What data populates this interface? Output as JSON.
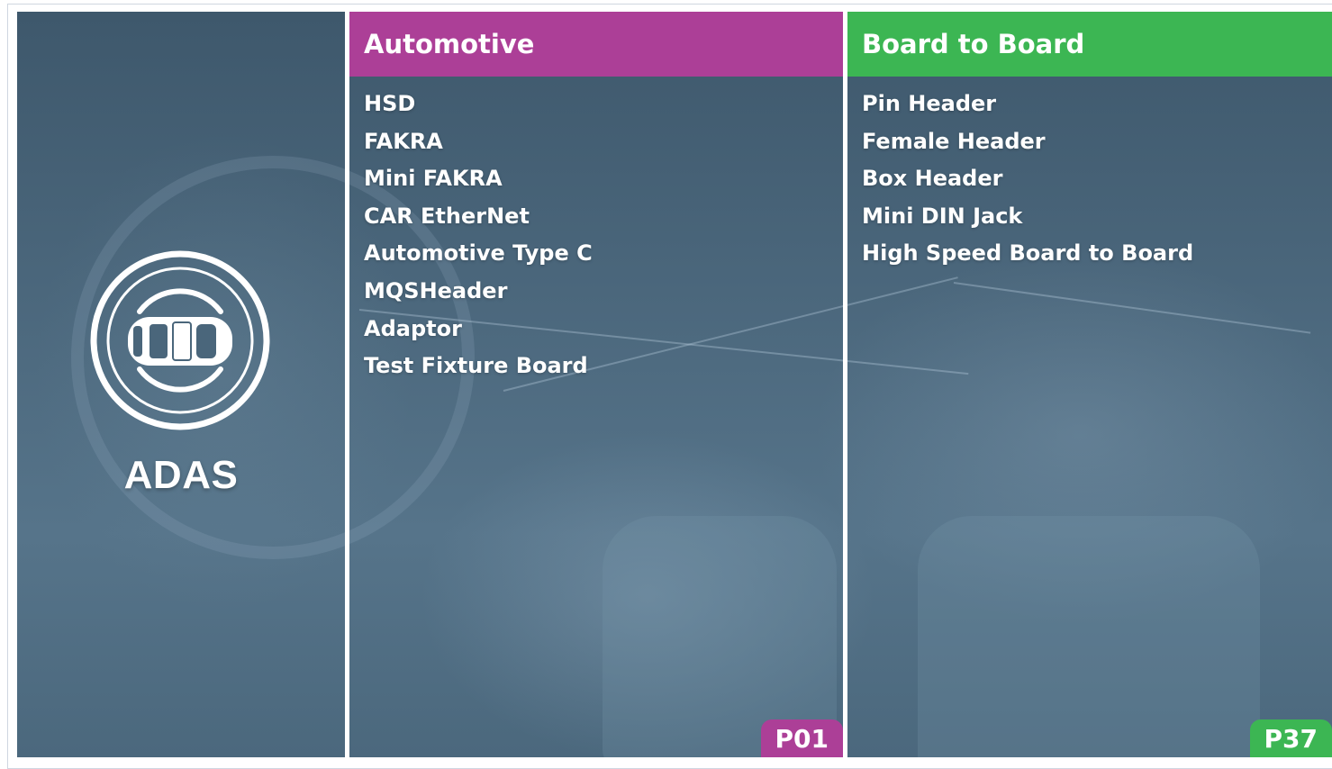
{
  "adas": {
    "title": "ADAS",
    "icon": "car-target-icon"
  },
  "columns": [
    {
      "title": "Automotive",
      "color": "#ac3f97",
      "items": [
        "HSD",
        "FAKRA",
        "Mini FAKRA",
        "CAR EtherNet",
        "Automotive Type C",
        "MQSHeader",
        "Adaptor",
        "Test Fixture Board"
      ],
      "page": "P01"
    },
    {
      "title": "Board to Board",
      "color": "#3cb653",
      "items": [
        "Pin Header",
        "Female Header",
        "Box Header",
        "Mini DIN Jack",
        "High Speed Board to Board"
      ],
      "page": "P37"
    }
  ]
}
